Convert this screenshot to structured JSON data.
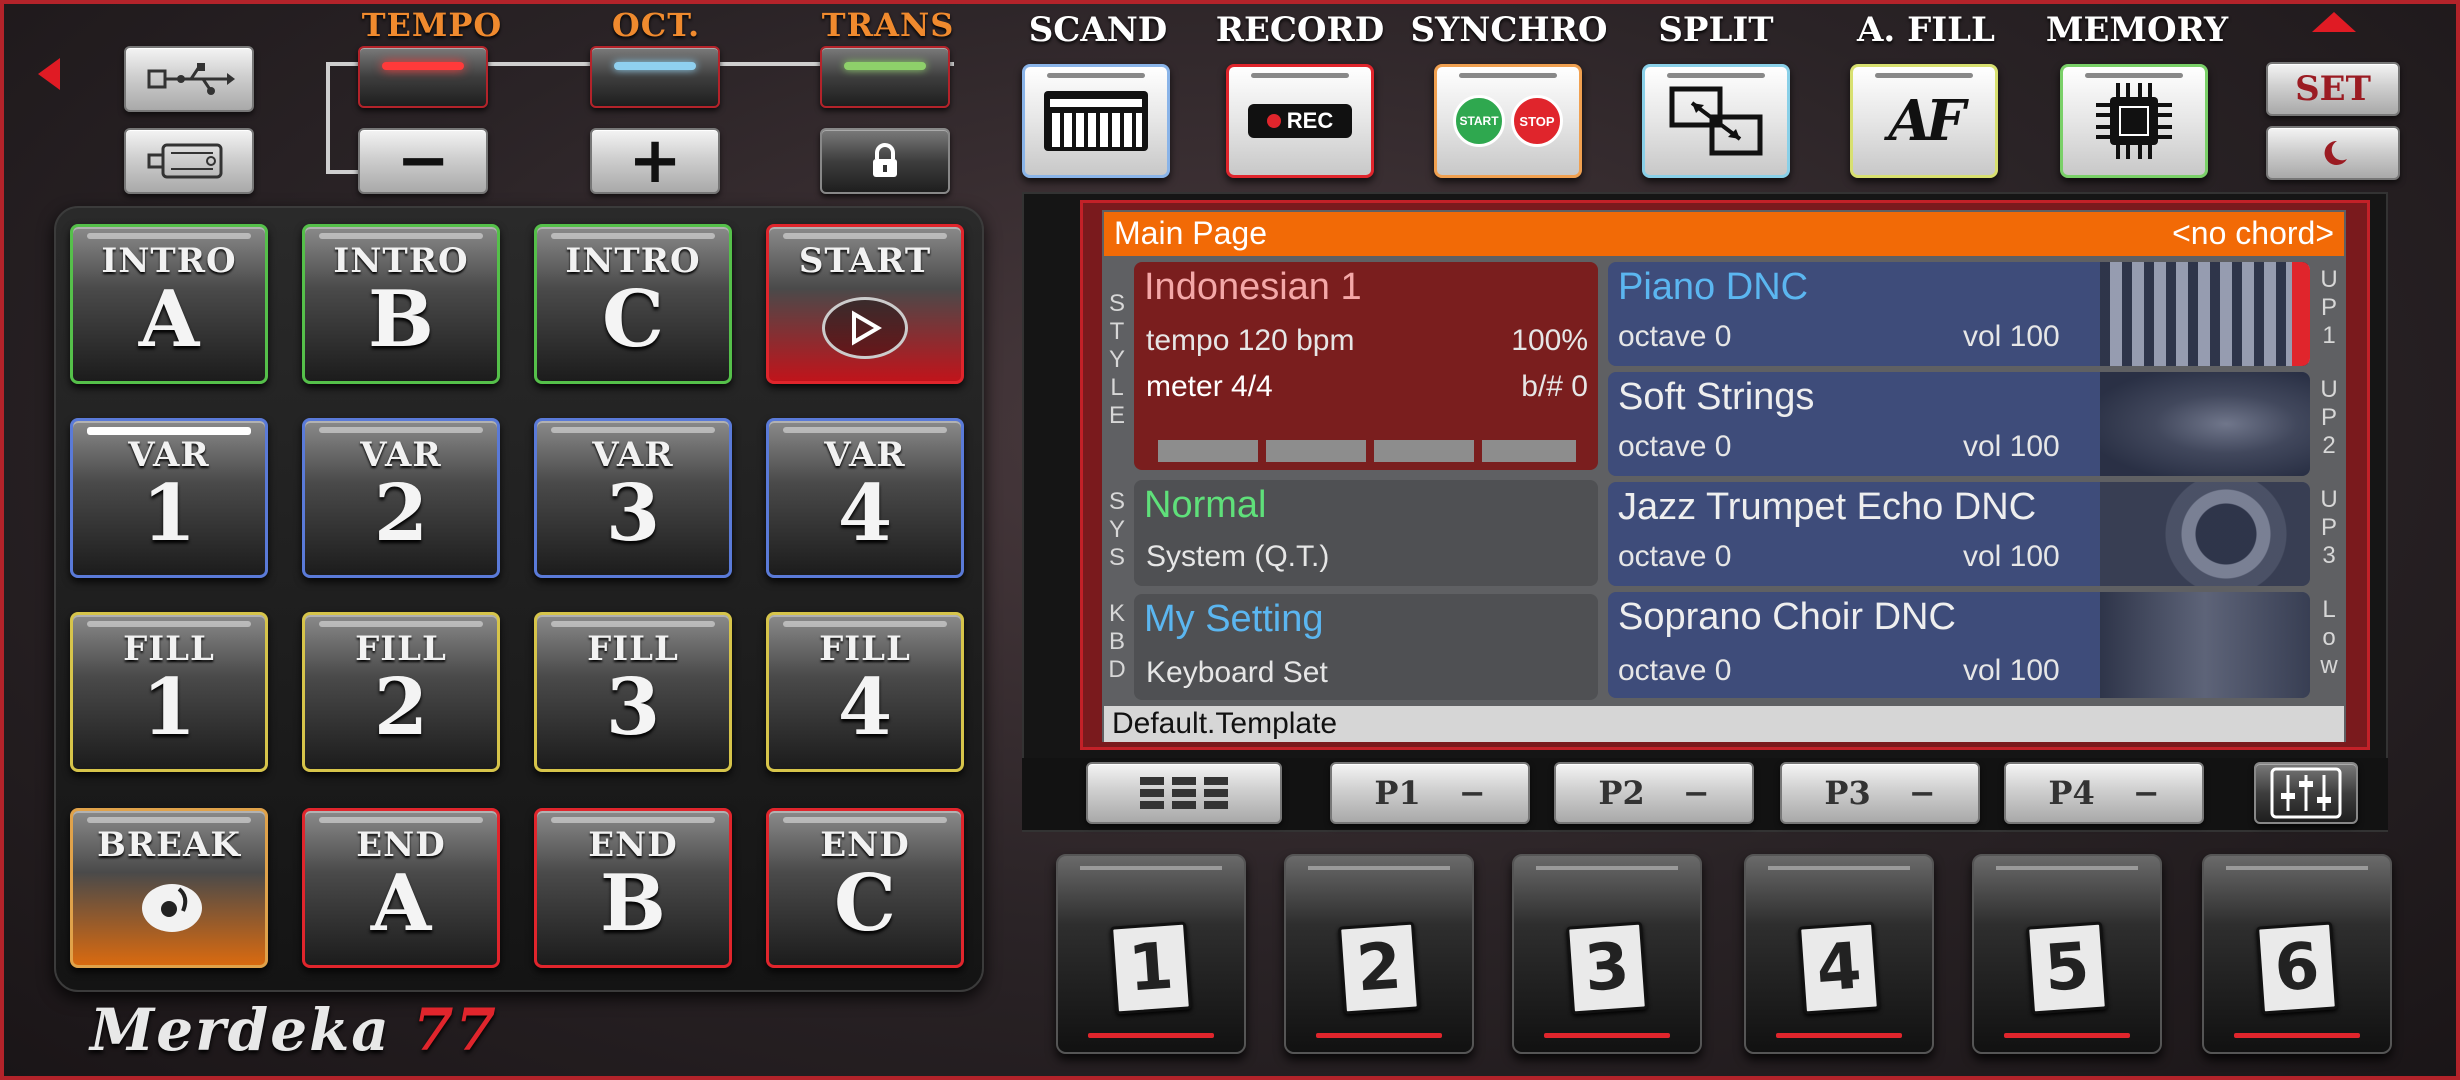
{
  "controls": {
    "tempo_label": "TEMPO",
    "oct_label": "OCT.",
    "trans_label": "TRANS",
    "minus": "−",
    "plus": "+"
  },
  "functions": [
    {
      "label": "SCAND"
    },
    {
      "label": "RECORD"
    },
    {
      "label": "SYNCHRO"
    },
    {
      "label": "SPLIT"
    },
    {
      "label": "A. FILL"
    },
    {
      "label": "MEMORY"
    }
  ],
  "function_icons": {
    "record_text": "REC",
    "start_text": "START",
    "stop_text": "STOP",
    "afill_text": "AF"
  },
  "set_label": "SET",
  "pads": {
    "intro_a": {
      "top": "INTRO",
      "big": "A"
    },
    "intro_b": {
      "top": "INTRO",
      "big": "B"
    },
    "intro_c": {
      "top": "INTRO",
      "big": "C"
    },
    "start": {
      "top": "START"
    },
    "var_1": {
      "top": "VAR",
      "big": "1"
    },
    "var_2": {
      "top": "VAR",
      "big": "2"
    },
    "var_3": {
      "top": "VAR",
      "big": "3"
    },
    "var_4": {
      "top": "VAR",
      "big": "4"
    },
    "fill_1": {
      "top": "FILL",
      "big": "1"
    },
    "fill_2": {
      "top": "FILL",
      "big": "2"
    },
    "fill_3": {
      "top": "FILL",
      "big": "3"
    },
    "fill_4": {
      "top": "FILL",
      "big": "4"
    },
    "break": {
      "top": "BREAK"
    },
    "end_a": {
      "top": "END",
      "big": "A"
    },
    "end_b": {
      "top": "END",
      "big": "B"
    },
    "end_c": {
      "top": "END",
      "big": "C"
    }
  },
  "logo": {
    "text": "Merdeka",
    "number": "77"
  },
  "display": {
    "header_title": "Main Page",
    "chord": "<no chord>",
    "side_style": "STYLE",
    "side_sys": "SYS",
    "side_kbd": "KBD",
    "style": {
      "name": "Indonesian 1",
      "tempo": "tempo 120 bpm",
      "tempo_pct": "100%",
      "meter": "meter 4/4",
      "key": "b/#  0"
    },
    "sys": {
      "name": "Normal",
      "sub": "System (Q.T.)"
    },
    "kbd": {
      "name": "My Setting",
      "sub": "Keyboard Set"
    },
    "voices": [
      {
        "side": "UP1",
        "name": "Piano DNC",
        "octave": "octave  0",
        "vol": "vol 100"
      },
      {
        "side": "UP2",
        "name": "Soft Strings",
        "octave": "octave  0",
        "vol": "vol 100"
      },
      {
        "side": "UP3",
        "name": "Jazz Trumpet Echo DNC",
        "octave": "octave  0",
        "vol": "vol 100"
      },
      {
        "side": "Low",
        "name": "Soprano Choir DNC",
        "octave": "octave  0",
        "vol": "vol 100"
      }
    ],
    "footer": "Default.Template"
  },
  "pages": [
    {
      "label": "P1",
      "dash": "−"
    },
    {
      "label": "P2",
      "dash": "−"
    },
    {
      "label": "P3",
      "dash": "−"
    },
    {
      "label": "P4",
      "dash": "−"
    }
  ],
  "memory": [
    "1",
    "2",
    "3",
    "4",
    "5",
    "6"
  ],
  "colors": {
    "accent_red": "#e0252c",
    "header_orange": "#f26a06",
    "voice_blue": "#3e4c7a",
    "style_red": "#7a1e1e",
    "label_orange": "#f08a2e"
  }
}
